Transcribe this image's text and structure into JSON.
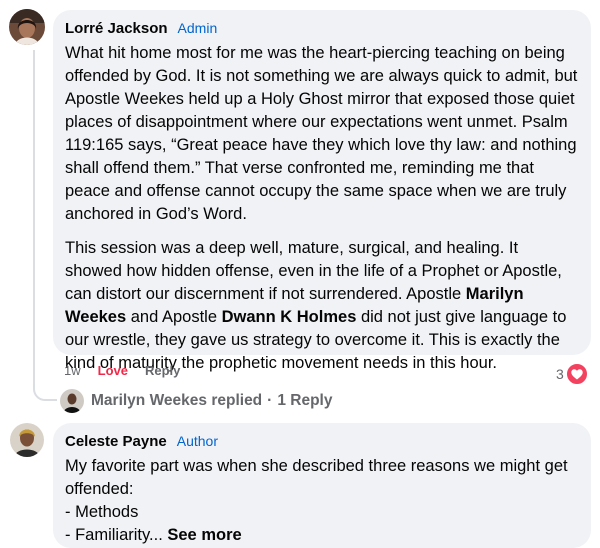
{
  "comments": [
    {
      "author": "Lorré Jackson",
      "role": "Admin",
      "paragraphs": [
        [
          {
            "t": "What hit home most for me was the heart-piercing teaching on being offended by God. It is not something we are always quick to admit, but Apostle Weekes held up a Holy Ghost mirror that exposed those quiet places of disappointment where our expectations went unmet. Psalm 119:165 says, “Great peace have they which love thy law: and nothing shall offend them.” That verse confronted me, reminding me that peace and offense cannot occupy the same space when we are truly anchored in God’s Word."
          }
        ],
        [
          {
            "t": "This session was a deep well, mature, surgical, and healing. It showed how hidden offense, even in the life of a Prophet or Apostle, can distort our discernment if not surrendered. Apostle "
          },
          {
            "t": "Marilyn Weekes",
            "b": true
          },
          {
            "t": " and Apostle "
          },
          {
            "t": "Dwann K Holmes",
            "b": true
          },
          {
            "t": " did not just give language to our wrestle, they gave us strategy to overcome it. This is exactly the kind of maturity the prophetic movement needs in this hour."
          }
        ]
      ],
      "actions": {
        "time": "1w",
        "reaction": "Love",
        "reply": "Reply"
      },
      "reaction_count": "3",
      "reaction_icon": "heart-icon",
      "replies_summary": {
        "replier": "Marilyn Weekes replied",
        "separator": "·",
        "count": "1 Reply"
      }
    },
    {
      "author": "Celeste Payne",
      "role": "Author",
      "lines": [
        "My favorite part was when she described three reasons we might get offended:",
        "- Methods",
        "- Familiarity..."
      ],
      "see_more": "See more"
    }
  ],
  "colors": {
    "bubble": "#f0f2f5",
    "badge": "#0064d1",
    "love": "#f02849",
    "muted": "#65676b"
  }
}
